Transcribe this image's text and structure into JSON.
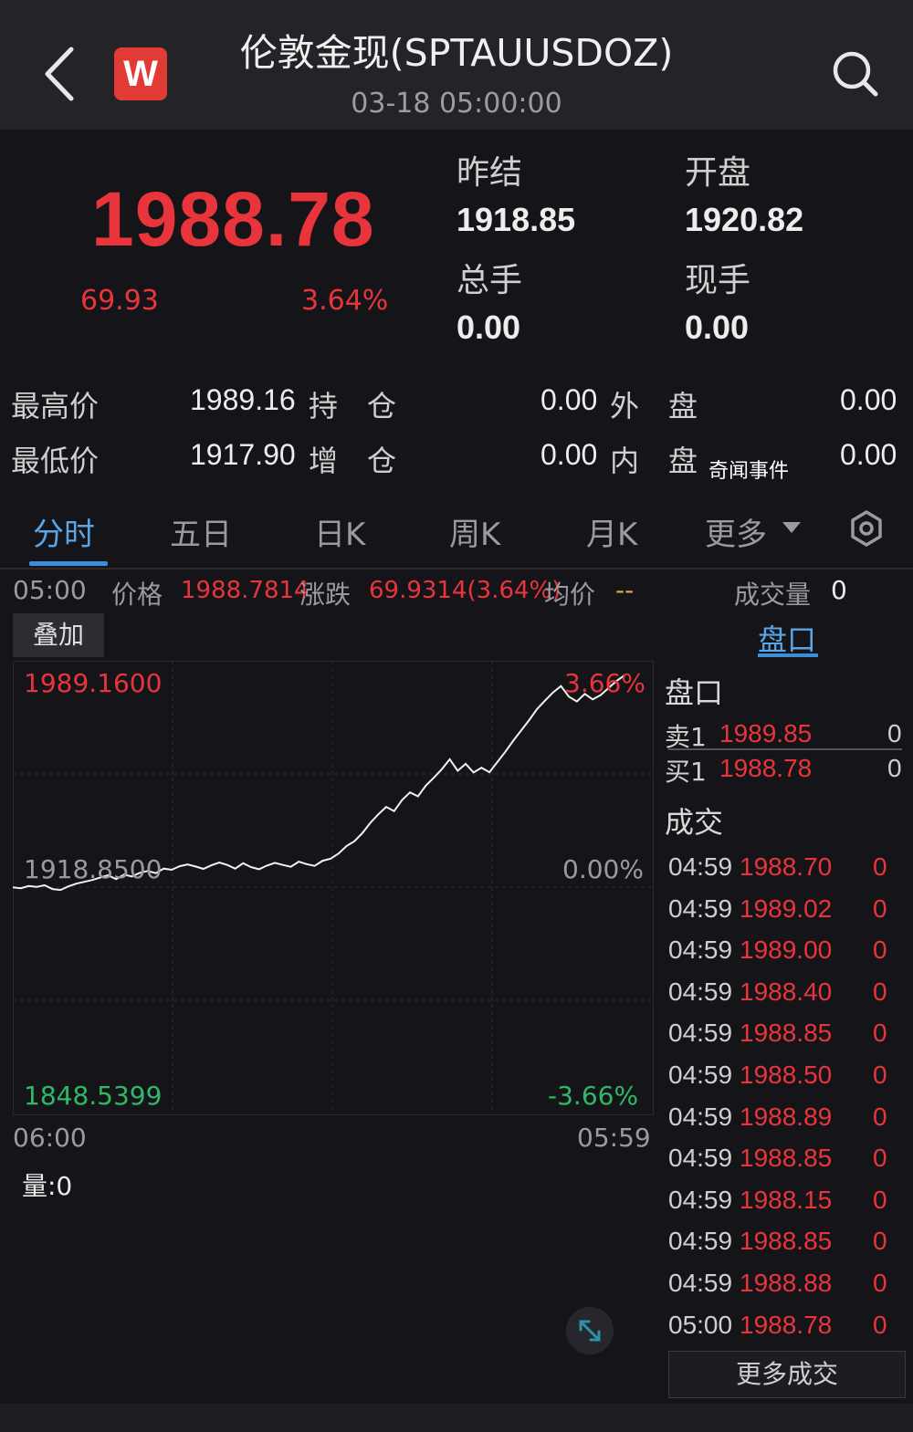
{
  "header": {
    "title": "伦敦金现(SPTAUUSDOZ)",
    "subtitle": "03-18 05:00:00",
    "logo_text": "W"
  },
  "quote": {
    "price": "1988.78",
    "change": "69.93",
    "change_pct": "3.64%",
    "prev_settle_label": "昨结",
    "prev_settle": "1918.85",
    "open_label": "开盘",
    "open": "1920.82",
    "total_hands_label": "总手",
    "total_hands": "0.00",
    "current_hands_label": "现手",
    "current_hands": "0.00"
  },
  "stats": {
    "high_label": "最高价",
    "high": "1989.16",
    "hold_label": "持　仓",
    "hold": "0.00",
    "outer_label": "外　盘",
    "outer": "0.00",
    "low_label": "最低价",
    "low": "1917.90",
    "add_label": "增　仓",
    "add": "0.00",
    "inner_label": "内　盘",
    "inner": "0.00",
    "watermark": "奇闻事件"
  },
  "tabs": [
    "分时",
    "五日",
    "日K",
    "周K",
    "月K",
    "更多"
  ],
  "info": {
    "time": "05:00",
    "price_label": "价格",
    "price": "1988.7814",
    "change_label": "涨跌",
    "change": "69.9314(3.64%)",
    "avg_label": "均价",
    "avg": "--",
    "volume_label": "成交量",
    "volume": "0"
  },
  "overlay_label": "叠加",
  "pankou_tab": "盘口",
  "chart": {
    "top_label": "1989.1600",
    "top_pct": "3.66%",
    "mid_label": "1918.8500",
    "mid_pct": "0.00%",
    "bottom_label": "1848.5399",
    "bottom_pct": "-3.66%",
    "x_start": "06:00",
    "x_end": "05:59",
    "volume_label": "量:0"
  },
  "chart_data": {
    "type": "line",
    "ylim": [
      1848.5399,
      1989.16
    ],
    "baseline": 1918.85,
    "x_range": [
      "06:00",
      "05:59"
    ],
    "series": [
      {
        "values": [
          1918.8,
          1918.5,
          1919.2,
          1918.9,
          1919.5,
          1918.2,
          1917.9,
          1919.1,
          1920.0,
          1920.6,
          1921.2,
          1922.0,
          1922.8,
          1921.5,
          1923.0,
          1922.4,
          1923.6,
          1924.2,
          1923.5,
          1925.0,
          1924.6,
          1925.8,
          1926.4,
          1925.7,
          1924.9,
          1926.1,
          1927.0,
          1926.2,
          1925.0,
          1926.8,
          1925.5,
          1924.8,
          1926.0,
          1926.9,
          1926.2,
          1925.6,
          1927.3,
          1926.5,
          1925.9,
          1927.6,
          1928.3,
          1930.0,
          1932.5,
          1934.1,
          1936.8,
          1940.2,
          1943.0,
          1945.5,
          1944.1,
          1947.8,
          1950.3,
          1949.0,
          1952.6,
          1955.2,
          1958.0,
          1961.3,
          1957.5,
          1959.8,
          1956.9,
          1958.5,
          1957.0,
          1960.4,
          1963.8,
          1967.5,
          1970.9,
          1974.3,
          1978.0,
          1980.8,
          1983.5,
          1985.6,
          1982.1,
          1980.5,
          1983.0,
          1981.2,
          1982.6,
          1985.0,
          1987.3,
          1989.16
        ]
      }
    ]
  },
  "side": {
    "pankou_title": "盘口",
    "sell1_label": "卖1",
    "sell1_price": "1989.85",
    "sell1_vol": "0",
    "buy1_label": "买1",
    "buy1_price": "1988.78",
    "buy1_vol": "0",
    "trades_title": "成交",
    "trades": [
      {
        "time": "04:59",
        "price": "1988.70",
        "vol": "0"
      },
      {
        "time": "04:59",
        "price": "1989.02",
        "vol": "0"
      },
      {
        "time": "04:59",
        "price": "1989.00",
        "vol": "0"
      },
      {
        "time": "04:59",
        "price": "1988.40",
        "vol": "0"
      },
      {
        "time": "04:59",
        "price": "1988.85",
        "vol": "0"
      },
      {
        "time": "04:59",
        "price": "1988.50",
        "vol": "0"
      },
      {
        "time": "04:59",
        "price": "1988.89",
        "vol": "0"
      },
      {
        "time": "04:59",
        "price": "1988.85",
        "vol": "0"
      },
      {
        "time": "04:59",
        "price": "1988.15",
        "vol": "0"
      },
      {
        "time": "04:59",
        "price": "1988.85",
        "vol": "0"
      },
      {
        "time": "04:59",
        "price": "1988.88",
        "vol": "0"
      },
      {
        "time": "05:00",
        "price": "1988.78",
        "vol": "0"
      }
    ],
    "more_label": "更多成交"
  },
  "colors": {
    "up": "#e8353b",
    "down": "#2fb865",
    "accent": "#3c8fd6",
    "background": "#151519"
  },
  "icons": [
    "back-arrow-icon",
    "search-icon",
    "settings-icon",
    "dropdown-triangle-icon",
    "expand-icon"
  ]
}
